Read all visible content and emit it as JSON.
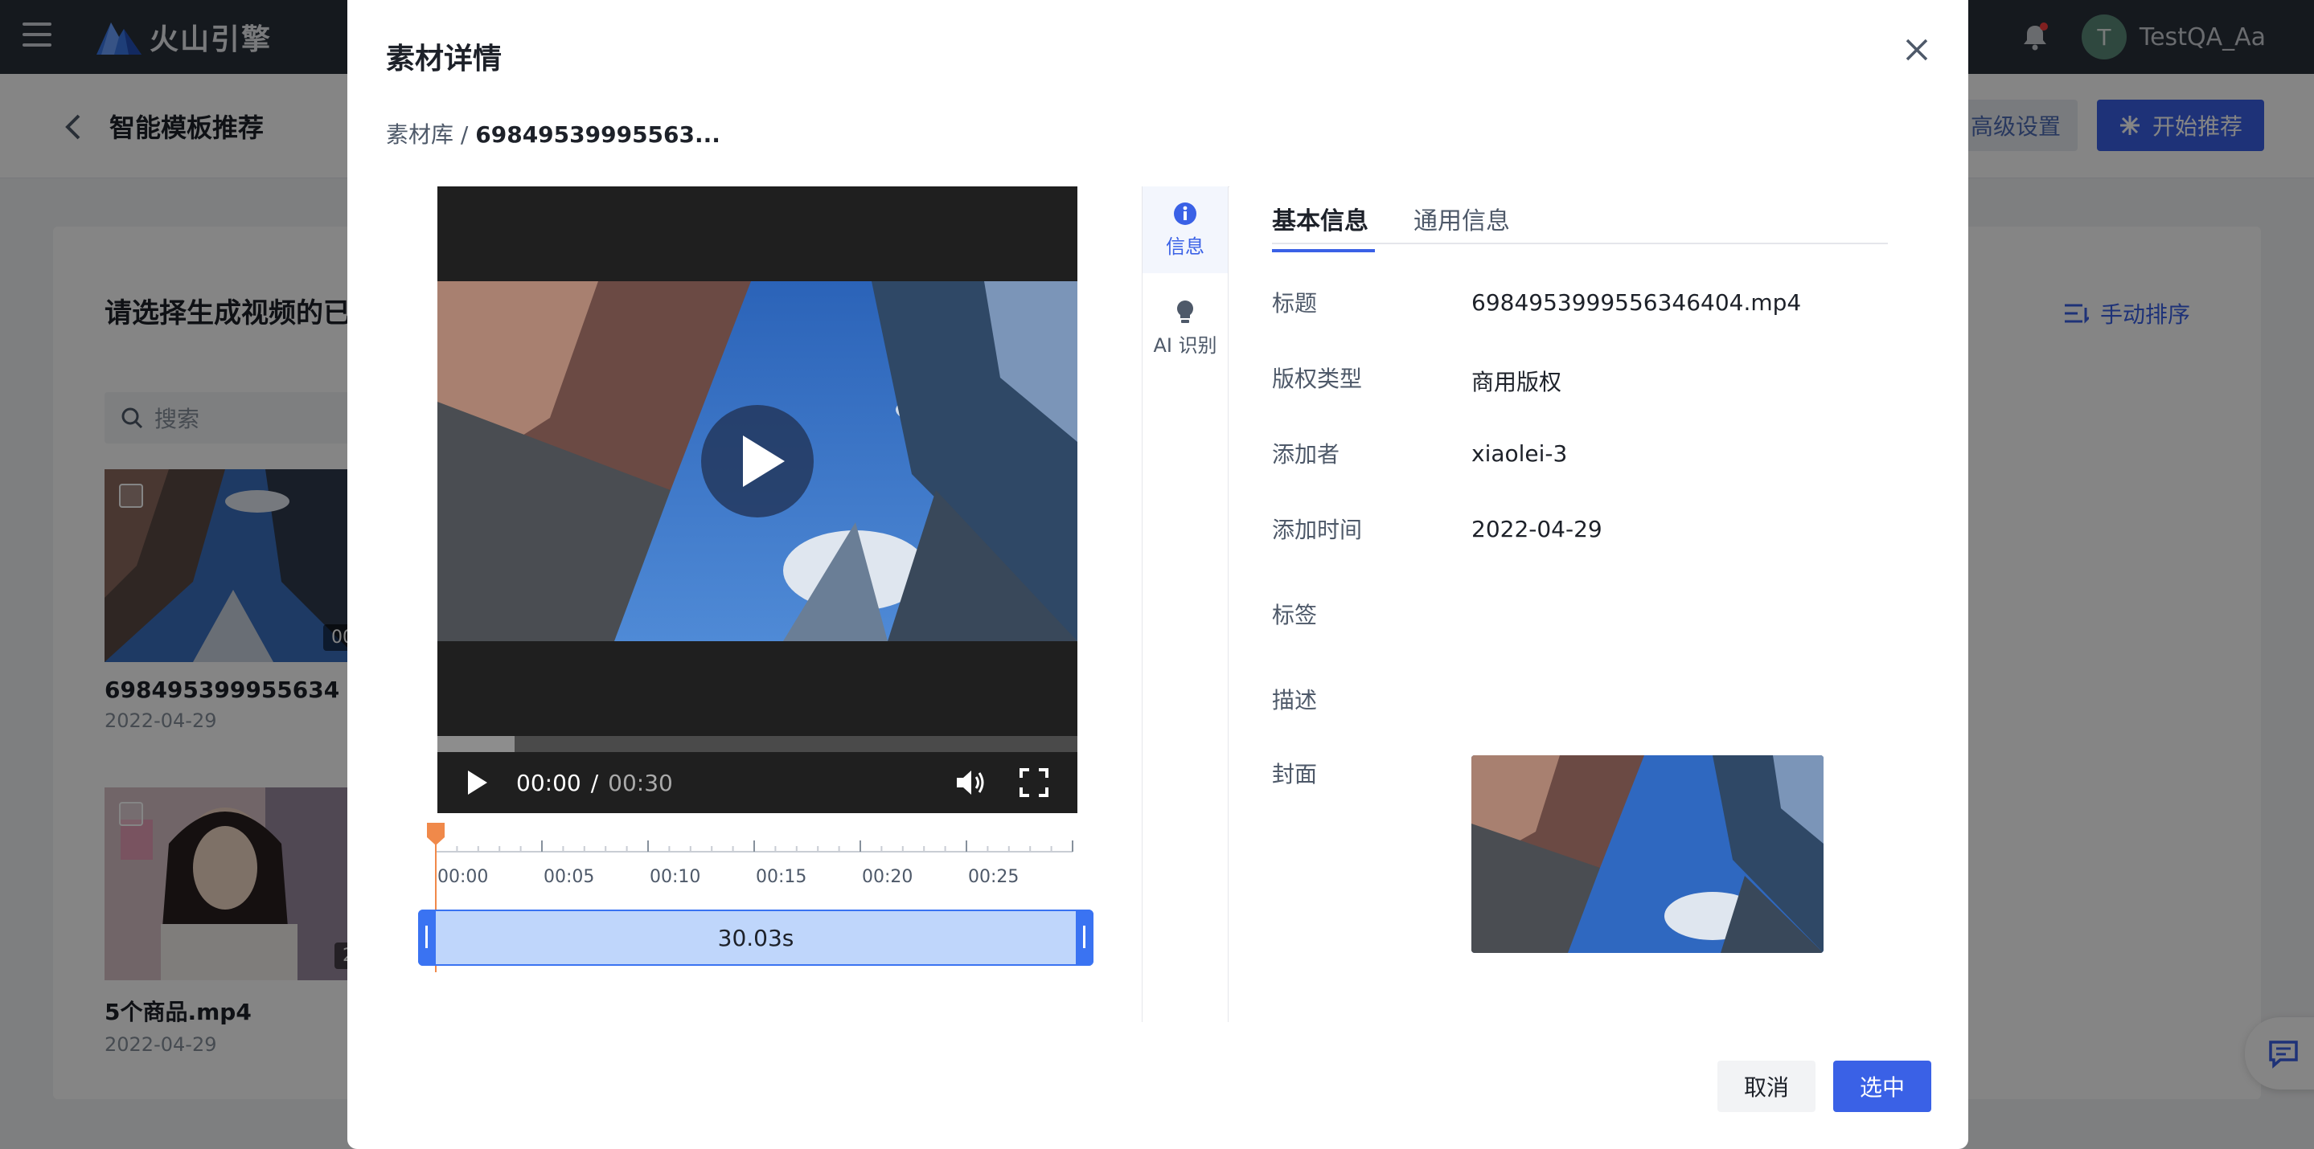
{
  "app": {
    "brand": "火山引擎",
    "user_initial": "T",
    "username": "TestQA_Aa"
  },
  "subheader": {
    "title": "智能模板推荐",
    "advanced_settings": "高级设置",
    "start_recommend": "开始推荐"
  },
  "background": {
    "heading": "请选择生成视频的已",
    "sort_label": "手动排序",
    "search_placeholder": "搜索",
    "cards": [
      {
        "name": "698495399955634",
        "date": "2022-04-29",
        "duration": "00"
      },
      {
        "name": "5个商品.mp4",
        "date": "2022-04-29",
        "duration": "2"
      }
    ]
  },
  "modal": {
    "title": "素材详情",
    "breadcrumb_root": "素材库 /",
    "breadcrumb_current": "69849539995563...",
    "player": {
      "current_time": "00:00",
      "separator": "/",
      "total_time": "00:30",
      "progress_fraction": 0.12
    },
    "timeline": {
      "ticks": [
        "00:00",
        "00:05",
        "00:10",
        "00:15",
        "00:20",
        "00:25"
      ],
      "clip_duration": "30.03s"
    },
    "side_tabs": {
      "info": "信息",
      "ai": "AI 识别"
    },
    "info_tabs": {
      "basic": "基本信息",
      "general": "通用信息"
    },
    "fields": {
      "title_label": "标题",
      "title_value": "6984953999556346404.mp4",
      "copyright_label": "版权类型",
      "copyright_value": "商用版权",
      "adder_label": "添加者",
      "adder_value": "xiaolei-3",
      "added_time_label": "添加时间",
      "added_time_value": "2022-04-29",
      "tags_label": "标签",
      "desc_label": "描述",
      "cover_label": "封面"
    },
    "buttons": {
      "cancel": "取消",
      "confirm": "选中"
    }
  },
  "colors": {
    "primary": "#3a61e6",
    "topbar": "#2a303b",
    "clip_fill": "#bfd6fb",
    "playhead": "#f0894a"
  }
}
